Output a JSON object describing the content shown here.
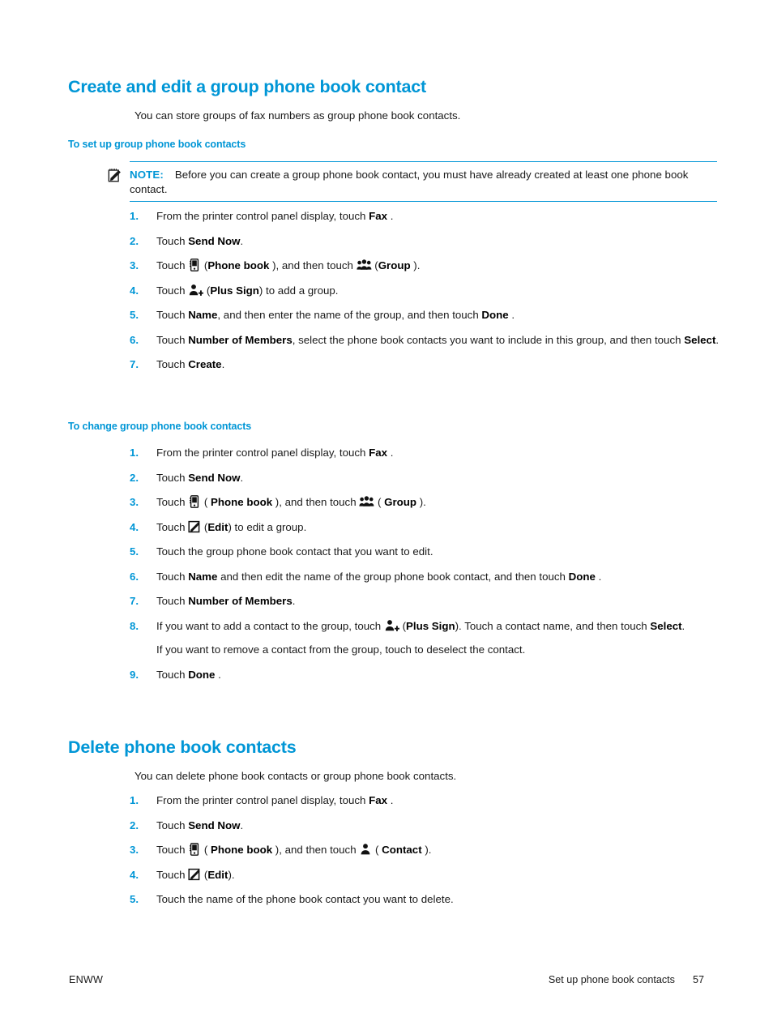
{
  "page": {
    "number": "57"
  },
  "sections": [
    {
      "id": "create-edit-group",
      "title": "Create and edit a group phone book contact",
      "intro": "You can store groups of fax numbers as group phone book contacts.",
      "subsections": [
        {
          "id": "to-set-up-group",
          "title": "To set up group phone book contacts",
          "note": {
            "label": "NOTE:",
            "text": "Before you can create a group phone book contact, you must have already created at least one phone book contact."
          },
          "steps": [
            {
              "num": "1.",
              "parts": [
                {
                  "t": "text",
                  "v": "From the printer control panel display, touch "
                },
                {
                  "t": "bold",
                  "v": "Fax"
                },
                {
                  "t": "text",
                  "v": " ."
                }
              ]
            },
            {
              "num": "2.",
              "parts": [
                {
                  "t": "text",
                  "v": "Touch "
                },
                {
                  "t": "bold",
                  "v": "Send Now"
                },
                {
                  "t": "text",
                  "v": "."
                }
              ]
            },
            {
              "num": "3.",
              "parts": [
                {
                  "t": "text",
                  "v": "Touch "
                },
                {
                  "t": "icon",
                  "v": "phone-book-icon"
                },
                {
                  "t": "text",
                  "v": " ("
                },
                {
                  "t": "bold",
                  "v": "Phone book"
                },
                {
                  "t": "text",
                  "v": " ), and then touch "
                },
                {
                  "t": "icon",
                  "v": "group-icon"
                },
                {
                  "t": "text",
                  "v": " ("
                },
                {
                  "t": "bold",
                  "v": "Group"
                },
                {
                  "t": "text",
                  "v": " )."
                }
              ]
            },
            {
              "num": "4.",
              "parts": [
                {
                  "t": "text",
                  "v": "Touch  "
                },
                {
                  "t": "icon",
                  "v": "plus-sign-icon"
                },
                {
                  "t": "text",
                  "v": " ("
                },
                {
                  "t": "bold",
                  "v": "Plus Sign"
                },
                {
                  "t": "text",
                  "v": ") to add a group."
                }
              ]
            },
            {
              "num": "5.",
              "parts": [
                {
                  "t": "text",
                  "v": "Touch "
                },
                {
                  "t": "bold",
                  "v": "Name"
                },
                {
                  "t": "text",
                  "v": ", and then enter the name of the group, and then touch "
                },
                {
                  "t": "bold",
                  "v": "Done"
                },
                {
                  "t": "text",
                  "v": " ."
                }
              ]
            },
            {
              "num": "6.",
              "parts": [
                {
                  "t": "text",
                  "v": "Touch "
                },
                {
                  "t": "bold",
                  "v": "Number of Members"
                },
                {
                  "t": "text",
                  "v": ", select the phone book contacts you want to include in this group, and then touch "
                },
                {
                  "t": "bold",
                  "v": "Select"
                },
                {
                  "t": "text",
                  "v": "."
                }
              ]
            },
            {
              "num": "7.",
              "parts": [
                {
                  "t": "text",
                  "v": "Touch "
                },
                {
                  "t": "bold",
                  "v": "Create"
                },
                {
                  "t": "text",
                  "v": "."
                }
              ]
            }
          ]
        },
        {
          "id": "to-change-group",
          "title": "To change group phone book contacts",
          "steps": [
            {
              "num": "1.",
              "parts": [
                {
                  "t": "text",
                  "v": "From the printer control panel display, touch "
                },
                {
                  "t": "bold",
                  "v": "Fax"
                },
                {
                  "t": "text",
                  "v": " ."
                }
              ]
            },
            {
              "num": "2.",
              "parts": [
                {
                  "t": "text",
                  "v": "Touch "
                },
                {
                  "t": "bold",
                  "v": "Send Now"
                },
                {
                  "t": "text",
                  "v": "."
                }
              ]
            },
            {
              "num": "3.",
              "parts": [
                {
                  "t": "text",
                  "v": "Touch "
                },
                {
                  "t": "icon",
                  "v": "phone-book-icon"
                },
                {
                  "t": "text",
                  "v": " ( "
                },
                {
                  "t": "bold",
                  "v": "Phone book"
                },
                {
                  "t": "text",
                  "v": " ), and then touch "
                },
                {
                  "t": "icon",
                  "v": "group-icon"
                },
                {
                  "t": "text",
                  "v": " ( "
                },
                {
                  "t": "bold",
                  "v": "Group"
                },
                {
                  "t": "text",
                  "v": " )."
                }
              ]
            },
            {
              "num": "4.",
              "parts": [
                {
                  "t": "text",
                  "v": "Touch "
                },
                {
                  "t": "icon",
                  "v": "edit-icon"
                },
                {
                  "t": "text",
                  "v": " ("
                },
                {
                  "t": "bold",
                  "v": "Edit"
                },
                {
                  "t": "text",
                  "v": ") to edit a group."
                }
              ]
            },
            {
              "num": "5.",
              "parts": [
                {
                  "t": "text",
                  "v": "Touch the group phone book contact that you want to edit."
                }
              ]
            },
            {
              "num": "6.",
              "parts": [
                {
                  "t": "text",
                  "v": "Touch "
                },
                {
                  "t": "bold",
                  "v": "Name"
                },
                {
                  "t": "text",
                  "v": " and then edit the name of the group phone book contact, and then touch "
                },
                {
                  "t": "bold",
                  "v": "Done"
                },
                {
                  "t": "text",
                  "v": " ."
                }
              ]
            },
            {
              "num": "7.",
              "parts": [
                {
                  "t": "text",
                  "v": "Touch "
                },
                {
                  "t": "bold",
                  "v": "Number of Members"
                },
                {
                  "t": "text",
                  "v": "."
                }
              ]
            },
            {
              "num": "8.",
              "parts": [
                {
                  "t": "text",
                  "v": "If you want to add a contact to the group, touch  "
                },
                {
                  "t": "icon",
                  "v": "plus-sign-icon"
                },
                {
                  "t": "text",
                  "v": " ("
                },
                {
                  "t": "bold",
                  "v": "Plus Sign"
                },
                {
                  "t": "text",
                  "v": "). Touch a contact name, and then touch "
                },
                {
                  "t": "bold",
                  "v": "Select"
                },
                {
                  "t": "text",
                  "v": "."
                }
              ],
              "sub": "If you want to remove a contact from the group, touch to deselect the contact."
            },
            {
              "num": "9.",
              "parts": [
                {
                  "t": "text",
                  "v": "Touch "
                },
                {
                  "t": "bold",
                  "v": "Done"
                },
                {
                  "t": "text",
                  "v": " ."
                }
              ]
            }
          ]
        }
      ]
    },
    {
      "id": "delete-phone-book-contacts",
      "title": "Delete phone book contacts",
      "intro": "You can delete phone book contacts or group phone book contacts.",
      "steps": [
        {
          "num": "1.",
          "parts": [
            {
              "t": "text",
              "v": "From the printer control panel display, touch "
            },
            {
              "t": "bold",
              "v": "Fax"
            },
            {
              "t": "text",
              "v": " ."
            }
          ]
        },
        {
          "num": "2.",
          "parts": [
            {
              "t": "text",
              "v": "Touch "
            },
            {
              "t": "bold",
              "v": "Send Now"
            },
            {
              "t": "text",
              "v": "."
            }
          ]
        },
        {
          "num": "3.",
          "parts": [
            {
              "t": "text",
              "v": "Touch "
            },
            {
              "t": "icon",
              "v": "phone-book-icon"
            },
            {
              "t": "text",
              "v": " ( "
            },
            {
              "t": "bold",
              "v": "Phone book"
            },
            {
              "t": "text",
              "v": " ), and then touch "
            },
            {
              "t": "icon",
              "v": "contact-icon"
            },
            {
              "t": "text",
              "v": " ( "
            },
            {
              "t": "bold",
              "v": "Contact"
            },
            {
              "t": "text",
              "v": " )."
            }
          ]
        },
        {
          "num": "4.",
          "parts": [
            {
              "t": "text",
              "v": "Touch "
            },
            {
              "t": "icon",
              "v": "edit-icon"
            },
            {
              "t": "text",
              "v": " ("
            },
            {
              "t": "bold",
              "v": "Edit"
            },
            {
              "t": "text",
              "v": ")."
            }
          ]
        },
        {
          "num": "5.",
          "parts": [
            {
              "t": "text",
              "v": "Touch the name of the phone book contact you want to delete."
            }
          ]
        }
      ]
    }
  ],
  "footer": {
    "left": "ENWW",
    "chapter": "Set up phone book contacts",
    "page_number": "57"
  },
  "colors": {
    "accent": "#0096d6",
    "text": "#1a1a1a"
  }
}
